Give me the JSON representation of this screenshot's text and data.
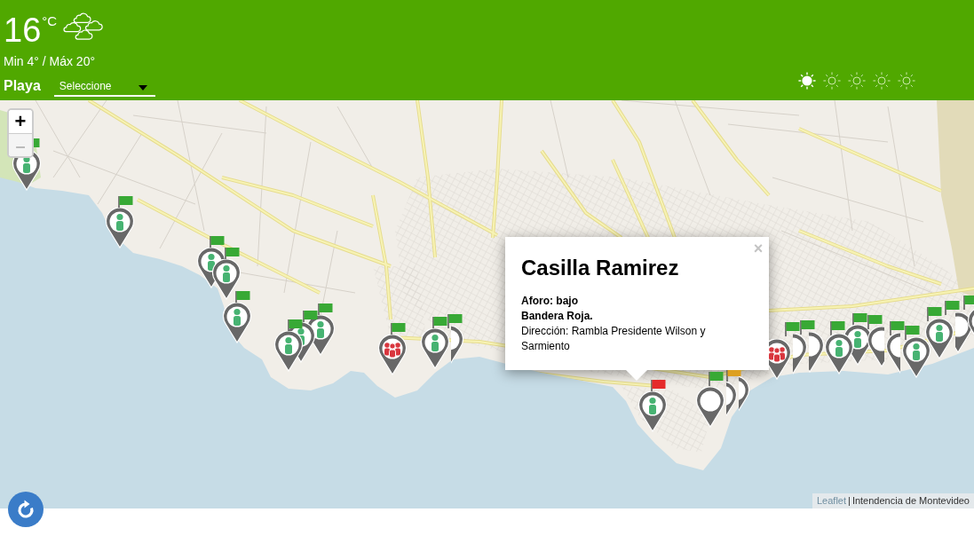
{
  "weather": {
    "temperature": "16",
    "unit": "°C",
    "min_max": "Min 4° / Máx 20°"
  },
  "beach_picker": {
    "label": "Playa",
    "value": "Seleccione"
  },
  "suns": [
    {
      "filled": true
    },
    {
      "filled": false
    },
    {
      "filled": false
    },
    {
      "filled": false
    },
    {
      "filled": false
    }
  ],
  "map": {
    "zoom_controls": [
      {
        "label": "+",
        "disabled": false
      },
      {
        "label": "–",
        "disabled": true
      }
    ],
    "markers": [
      {
        "kind": "person",
        "color": "#38a935"
      },
      {
        "kind": "person",
        "color": "#38a935"
      },
      {
        "kind": "person",
        "color": "#38a935"
      },
      {
        "kind": "person",
        "color": "#38a935"
      },
      {
        "kind": "person",
        "color": "#38a935"
      },
      {
        "kind": "person",
        "color": "#38a935"
      },
      {
        "kind": "empty",
        "color": "#38a935"
      },
      {
        "kind": "person",
        "color": "#38a935"
      },
      {
        "kind": "person",
        "color": "#38a935"
      },
      {
        "kind": "person",
        "color": "#38a935"
      },
      {
        "kind": "person",
        "color": "#38a935"
      },
      {
        "kind": "empty",
        "color": "#38a935"
      },
      {
        "kind": "person",
        "color": "#38a935"
      },
      {
        "kind": "person",
        "color": "#38a935"
      },
      {
        "kind": "person",
        "color": "#38a935"
      },
      {
        "kind": "empty",
        "color": "#38a935"
      },
      {
        "kind": "empty",
        "color": "#38a935"
      },
      {
        "kind": "empty",
        "color": "#38a935"
      },
      {
        "kind": "person",
        "color": "#38a935"
      },
      {
        "kind": "group",
        "color": "#38a935"
      },
      {
        "kind": "person",
        "color": "#38a935"
      },
      {
        "kind": "group"
      },
      {
        "kind": "empty",
        "color": "#dda020"
      },
      {
        "kind": "empty"
      },
      {
        "kind": "empty",
        "color": "#38a935"
      },
      {
        "kind": "person",
        "color": "#e52b2b"
      }
    ],
    "popup": {
      "title": "Casilla Ramirez",
      "occupancy": "Aforo: bajo",
      "flag": "Bandera Roja.",
      "address": "Dirección: Rambla Presidente Wilson y Sarmiento",
      "close": "×"
    },
    "attribution": {
      "link": "Leaflet",
      "separator": "|",
      "text": "Intendencia de Montevideo"
    }
  }
}
